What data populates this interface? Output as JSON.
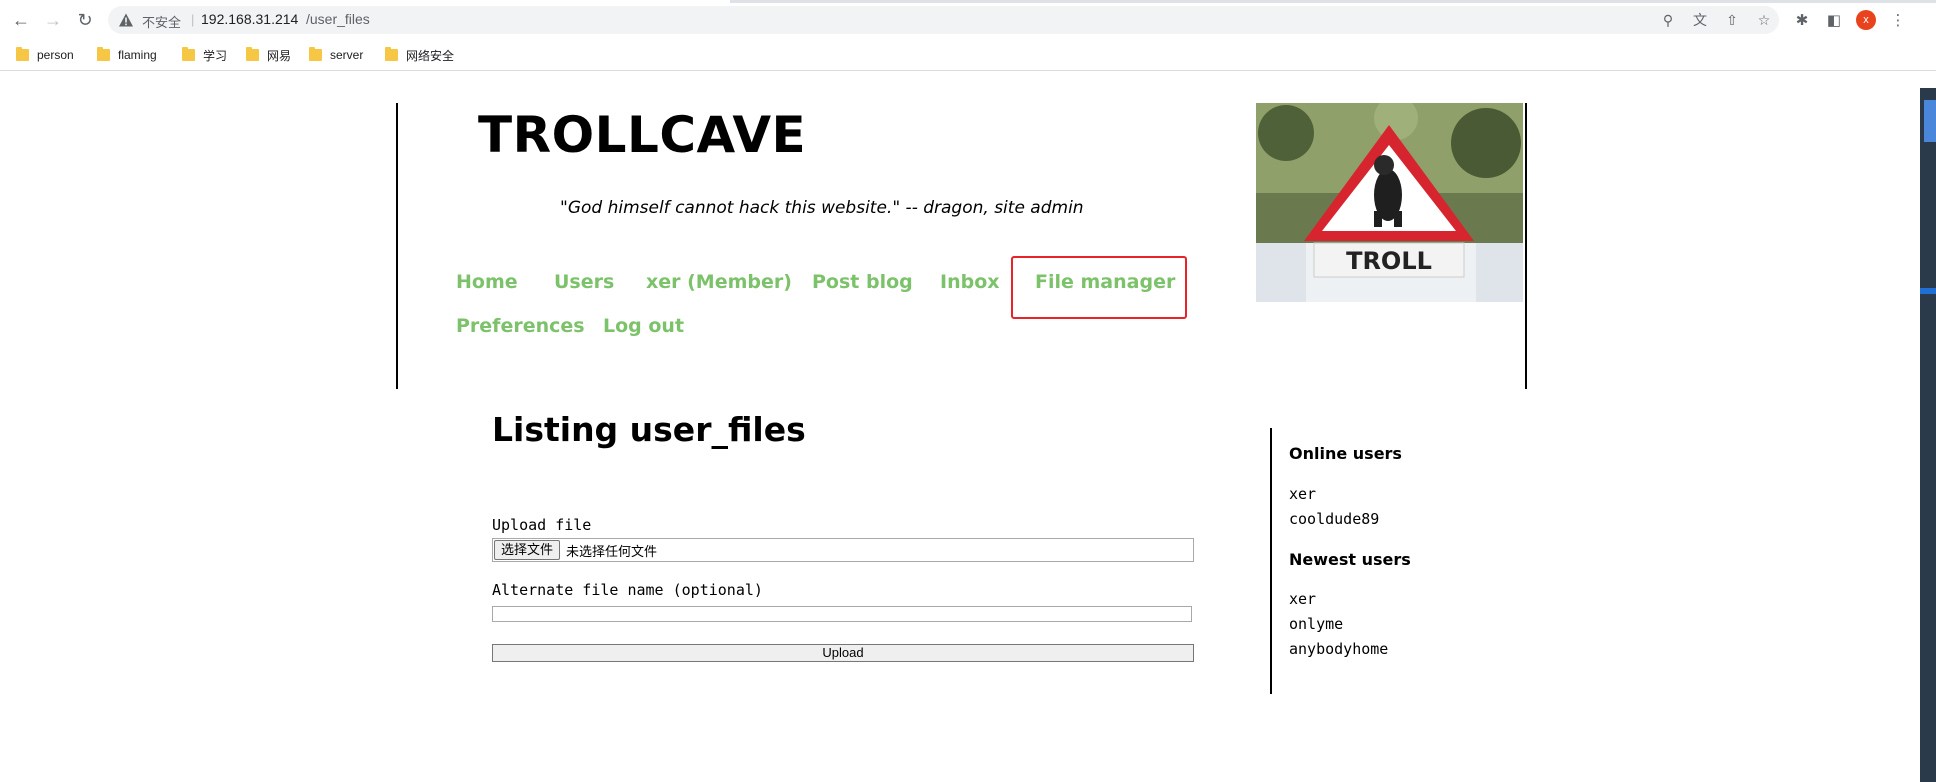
{
  "browser": {
    "security_label": "不安全",
    "separator": "|",
    "url_host": "192.168.31.214",
    "url_path": "/user_files",
    "avatar_letter": "x",
    "bookmarks": [
      "person",
      "flaming",
      "学习",
      "网易",
      "server",
      "网络安全"
    ]
  },
  "site": {
    "title": "TROLLCAVE",
    "tagline": "\"God himself cannot hack this website.\" -- dragon, site admin",
    "nav": [
      "Home",
      "Users",
      "xer (Member)",
      "Post blog",
      "Inbox",
      "File manager",
      "Preferences",
      "Log out"
    ],
    "link_color": "#7cc26a",
    "highlight_color": "#e8242a",
    "sign_text": "TROLL"
  },
  "main": {
    "heading": "Listing user_files",
    "upload_label": "Upload file",
    "choose_button": "选择文件",
    "no_file_text": "未选择任何文件",
    "alt_name_label": "Alternate file name (optional)",
    "alt_name_value": "",
    "upload_button": "Upload"
  },
  "sidebar": {
    "online_heading": "Online users",
    "online_users": [
      "xer",
      "cooldude89"
    ],
    "newest_heading": "Newest users",
    "newest_users": [
      "xer",
      "onlyme",
      "anybodyhome"
    ]
  }
}
